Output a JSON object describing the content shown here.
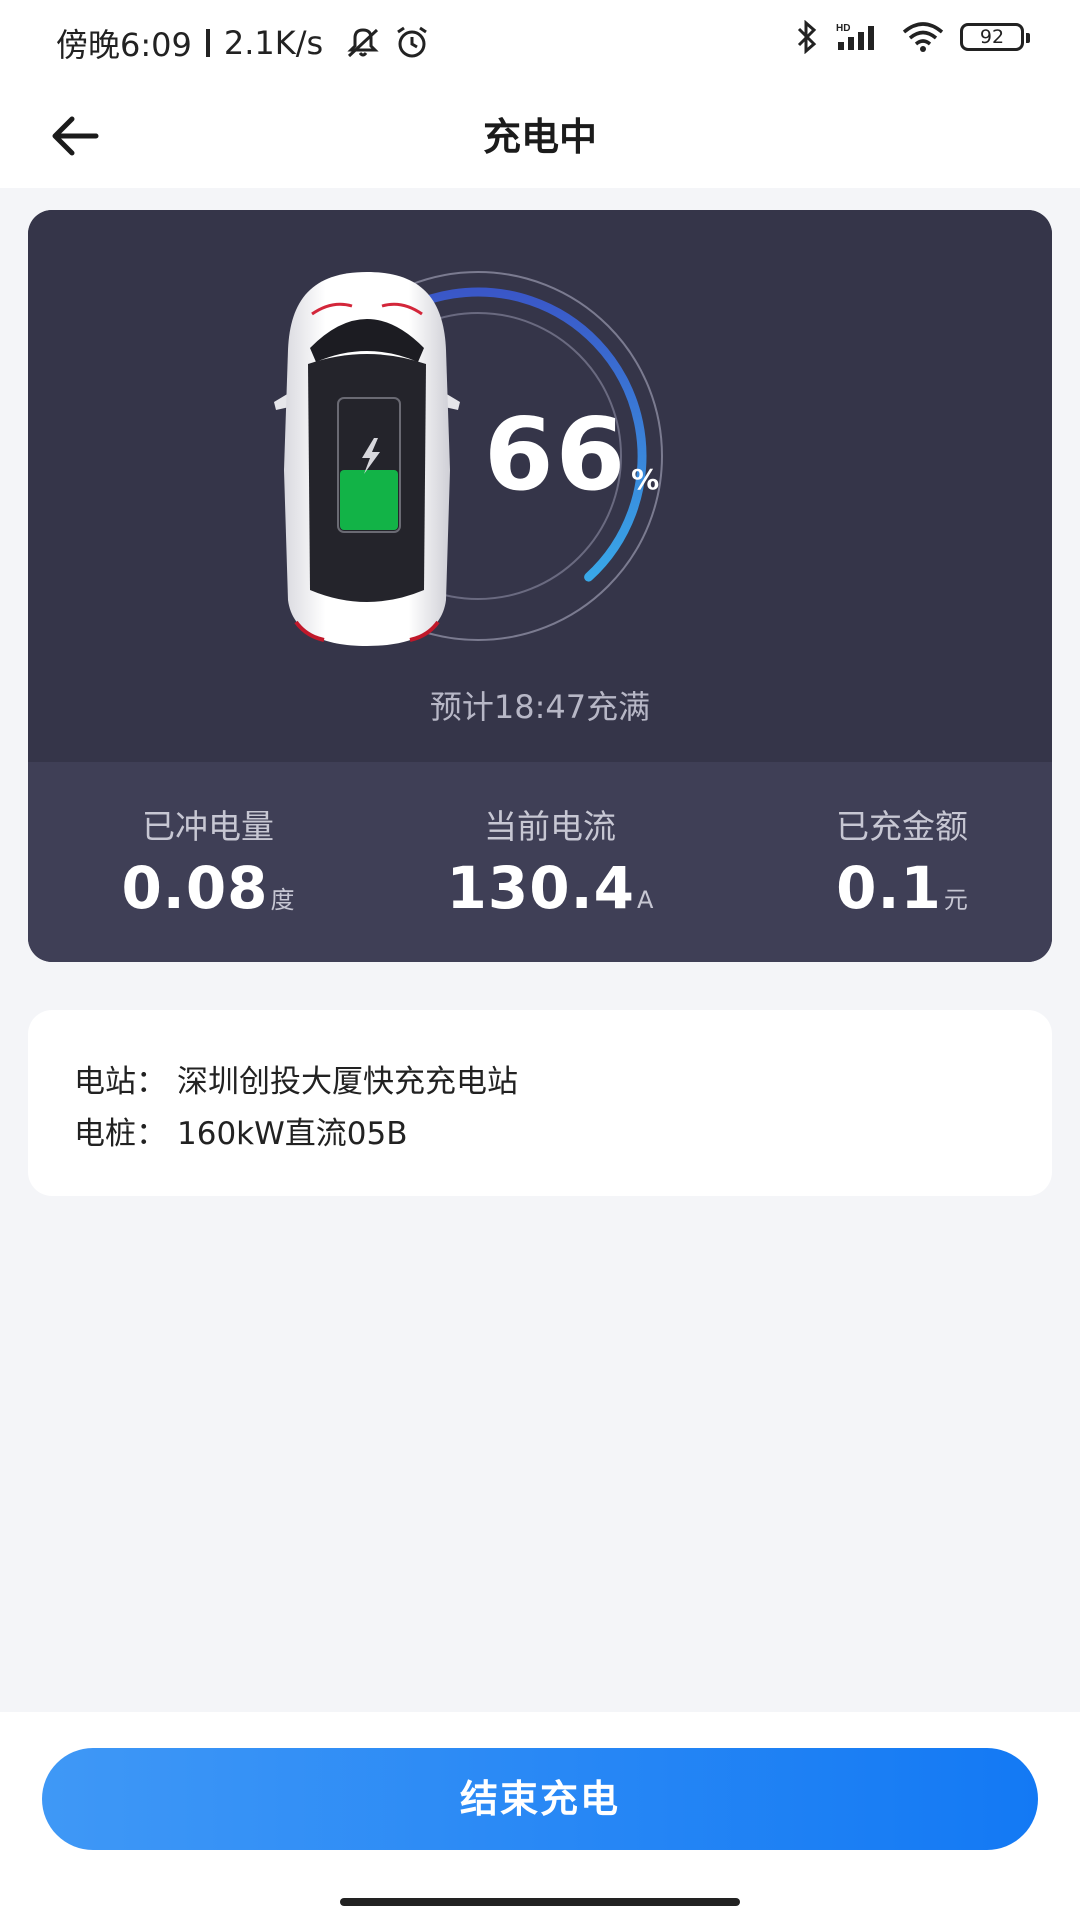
{
  "status_bar": {
    "time": "傍晚6:09",
    "speed": "2.1K/s",
    "battery": "92",
    "icons": [
      "mute-icon",
      "alarm-icon",
      "bluetooth-icon",
      "signal-icon",
      "wifi-icon",
      "battery-icon"
    ]
  },
  "header": {
    "title": "充电中",
    "back_icon": "arrow-left-icon"
  },
  "charge": {
    "percent": "66",
    "percent_unit": "%",
    "percent_value": 66,
    "eta": "预计18:47充满",
    "colors": {
      "card": "#353549",
      "card_stats": "#3f3f56",
      "arc_start": "#3a57c8",
      "arc_end": "#39a8e8",
      "battery_fill": "#12b347"
    }
  },
  "stats": [
    {
      "label": "已冲电量",
      "value": "0.08",
      "unit": "度"
    },
    {
      "label": "当前电流",
      "value": "130.4",
      "unit": "A"
    },
    {
      "label": "已充金额",
      "value": "0.1",
      "unit": "元"
    }
  ],
  "station": {
    "station_label": "电站：",
    "station_name": "深圳创投大厦快充充电站",
    "pile_label": "电桩：",
    "pile_name": "160kW直流05B"
  },
  "actions": {
    "end_label": "结束充电",
    "accent": "#1a7ff5"
  }
}
